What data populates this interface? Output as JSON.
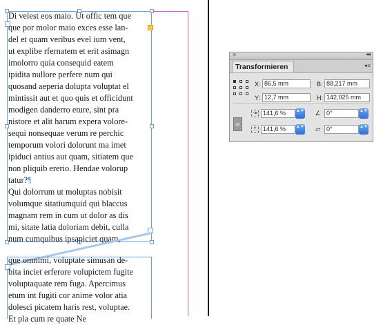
{
  "frame1_lines": [
    "Di velest eos maio. Ut offic tem que",
    "que por molor maio exces esse lan-",
    "del et quam veribus evel ium vent,",
    "ut explibe rfernatem et erit asimagn",
    "imolorro quia consequid eatem",
    "ipidita nullore perfere num qui",
    "quosand aeperia dolupta voluptat el",
    "mintissit aut et quo quis et officidunt",
    "modigen danderro eture, sint pra",
    "nistore et alit harum expera volore-",
    "sequi nonsequae verum re perchic",
    "temporum volori dolorunt ma imet",
    "ipiduci antius aut quam, sitiatem que",
    "non pliquib ererio. Hendae volorup",
    "tatur?",
    "Qui dolorrum ut moluptas nobisit",
    "volumque sitatiumquid qui blaccus",
    "magnam rem in cum ut dolor as dis",
    "mi, sitate latia doloriam debit, culla",
    "num cumquibus ipsapiciet quam,"
  ],
  "pilcrow": "¶",
  "frame2_lines": [
    "que omnimi, voluptate simusan de-",
    "bita inciet erferore volupictem fugite",
    "voluptaquate rem fuga. Apercimus",
    "etum int fugiti cor anime volor atia",
    "dolesci picatem haris rest, voluptae.",
    "Et pla cum re quate Ne"
  ],
  "panel": {
    "close_glyph": "×",
    "collapse_glyph": "◂◂",
    "tab_label": "Transformieren",
    "menu_glyph": "▾≡",
    "x_label": "X:",
    "x_value": "86,5 mm",
    "y_label": "Y:",
    "y_value": "12,7 mm",
    "w_label": "B:",
    "w_value": "88,217 mm",
    "h_label": "H:",
    "h_value": "142,025 mm",
    "scale_x_value": "141,6 %",
    "scale_y_value": "141,6 %",
    "rotate_value": "0°",
    "shear_value": "0°",
    "chain_glyph": "∞",
    "rotate_glyph": "∠",
    "shear_glyph": "⏥",
    "scale_x_glyph": "⇥",
    "scale_y_glyph": "⇡",
    "stepper_glyph": "▲▼"
  },
  "colors": {
    "frame_selection": "#6aa0d6",
    "margin_guide": "#c060c0",
    "overset_port": "#f2cf3c",
    "stepper_accent": "#2f6fd1"
  }
}
